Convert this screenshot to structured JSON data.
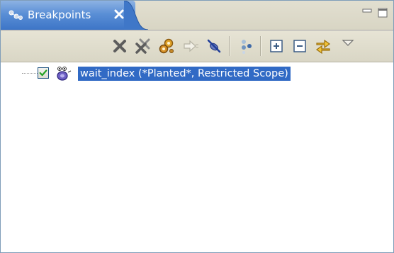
{
  "view": {
    "tab_title": "Breakpoints"
  },
  "toolbar": {
    "buttons": [
      {
        "name": "remove-selected-breakpoints",
        "icon": "remove-x-icon"
      },
      {
        "name": "remove-all-breakpoints",
        "icon": "remove-all-icon"
      },
      {
        "name": "show-supported-breakpoints",
        "icon": "gears-icon"
      },
      {
        "name": "go-to-file",
        "icon": "arrow-right-icon"
      },
      {
        "name": "skip-all-breakpoints",
        "icon": "skip-breakpoints-icon"
      },
      {
        "name": "show-breakpoints-by-type",
        "icon": "group-icon"
      },
      {
        "name": "expand-all",
        "icon": "expand-all-icon"
      },
      {
        "name": "collapse-all",
        "icon": "collapse-all-icon"
      },
      {
        "name": "link-with-debug-view",
        "icon": "link-icon"
      },
      {
        "name": "view-menu",
        "icon": "view-menu-triangle-icon"
      }
    ]
  },
  "breakpoints": [
    {
      "label": "wait_index (*Planted*, Restricted Scope)",
      "checked": true,
      "selected": true
    }
  ],
  "colors": {
    "tab_active": "#3d75c7",
    "selection": "#316ac5",
    "toolbar_bg": "#e1ded0"
  }
}
